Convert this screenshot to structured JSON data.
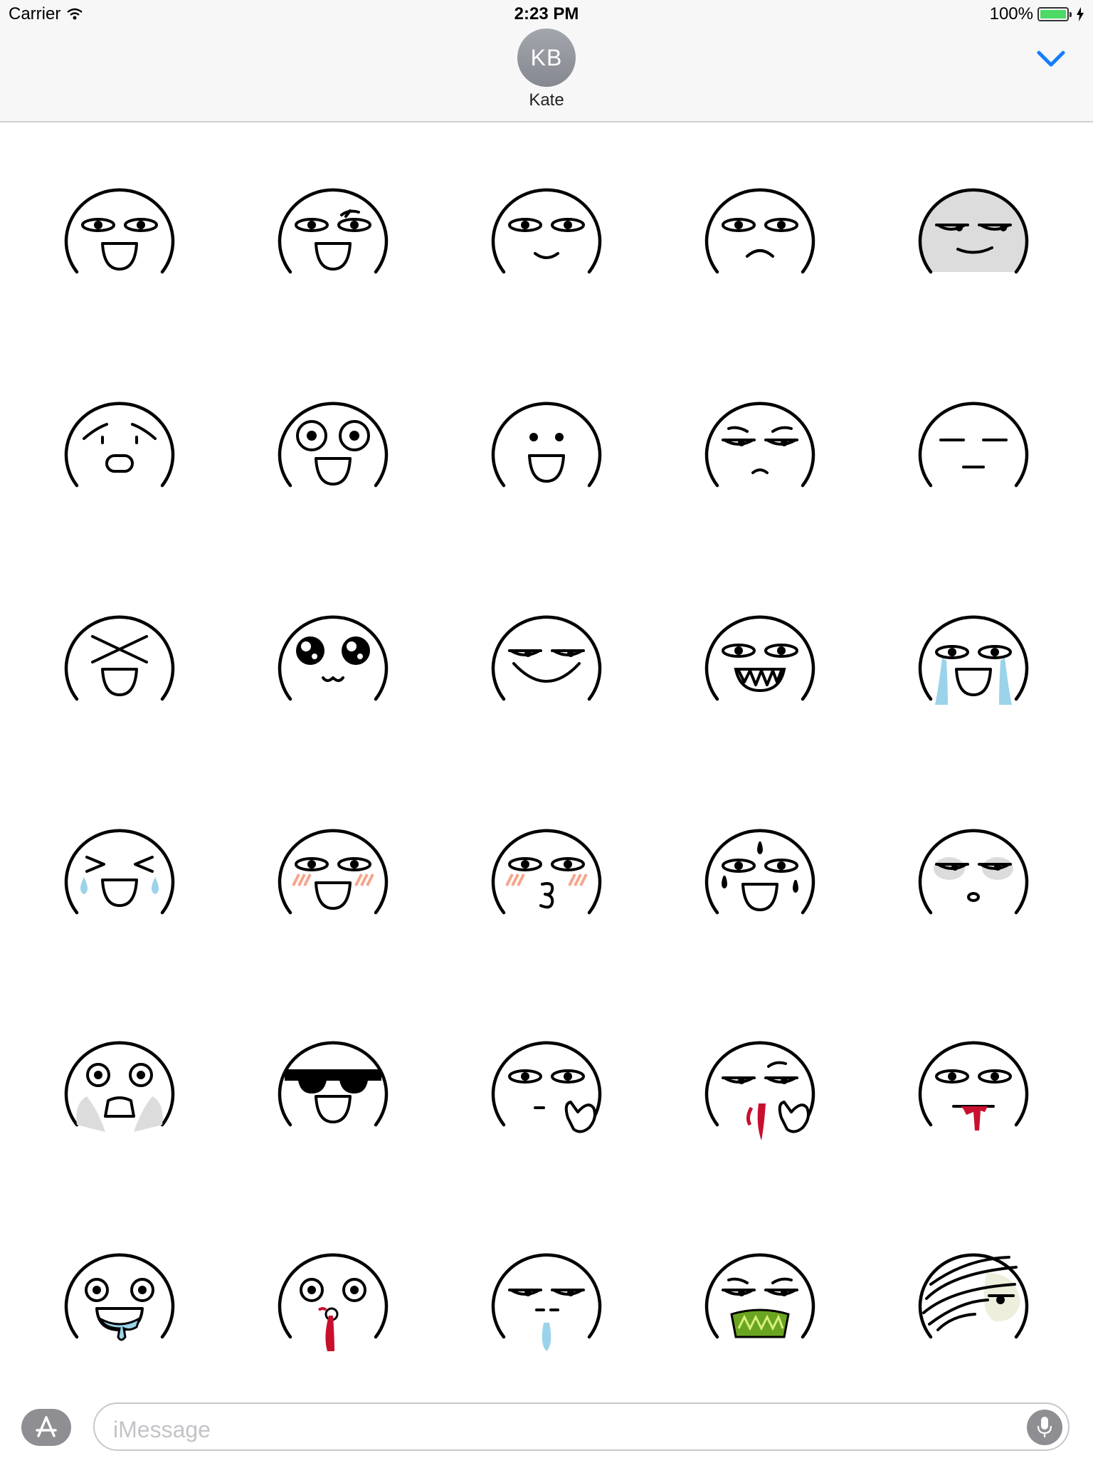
{
  "status_bar": {
    "carrier": "Carrier",
    "time": "2:23 PM",
    "battery": "100%",
    "battery_level": 1.0
  },
  "contact": {
    "initials": "KB",
    "name": "Kate"
  },
  "composer": {
    "placeholder": "iMessage"
  },
  "colors": {
    "accent": "#157efb",
    "tears": "#9bd3ea",
    "blood": "#c8102e",
    "blush": "#f4a68c",
    "vomit": "#6aa521",
    "shade": "#dcdcdc"
  },
  "icons": {
    "collapse": "chevron-down-icon",
    "app_store": "app-store-icon",
    "mic": "microphone-icon",
    "wifi": "wifi-icon",
    "battery": "battery-icon",
    "charging": "bolt-icon"
  },
  "stickers": [
    {
      "name": "sticker-grin"
    },
    {
      "name": "sticker-grin-raised-brow"
    },
    {
      "name": "sticker-smirk"
    },
    {
      "name": "sticker-frown"
    },
    {
      "name": "sticker-gray-smug"
    },
    {
      "name": "sticker-distressed"
    },
    {
      "name": "sticker-wide-eyes"
    },
    {
      "name": "sticker-dot-eyes-smile"
    },
    {
      "name": "sticker-worried"
    },
    {
      "name": "sticker-expressionless"
    },
    {
      "name": "sticker-x-eyes"
    },
    {
      "name": "sticker-sparkle-eyes"
    },
    {
      "name": "sticker-big-smile"
    },
    {
      "name": "sticker-sharp-teeth"
    },
    {
      "name": "sticker-crying-smile"
    },
    {
      "name": "sticker-tears-of-joy"
    },
    {
      "name": "sticker-blushing"
    },
    {
      "name": "sticker-kiss"
    },
    {
      "name": "sticker-sweating"
    },
    {
      "name": "sticker-tired"
    },
    {
      "name": "sticker-shocked"
    },
    {
      "name": "sticker-sunglasses"
    },
    {
      "name": "sticker-thinking"
    },
    {
      "name": "sticker-nosebleed"
    },
    {
      "name": "sticker-blood-mouth"
    },
    {
      "name": "sticker-drooling"
    },
    {
      "name": "sticker-bleeding-mouth"
    },
    {
      "name": "sticker-runny-nose"
    },
    {
      "name": "sticker-vomiting"
    },
    {
      "name": "sticker-bandaged"
    }
  ]
}
